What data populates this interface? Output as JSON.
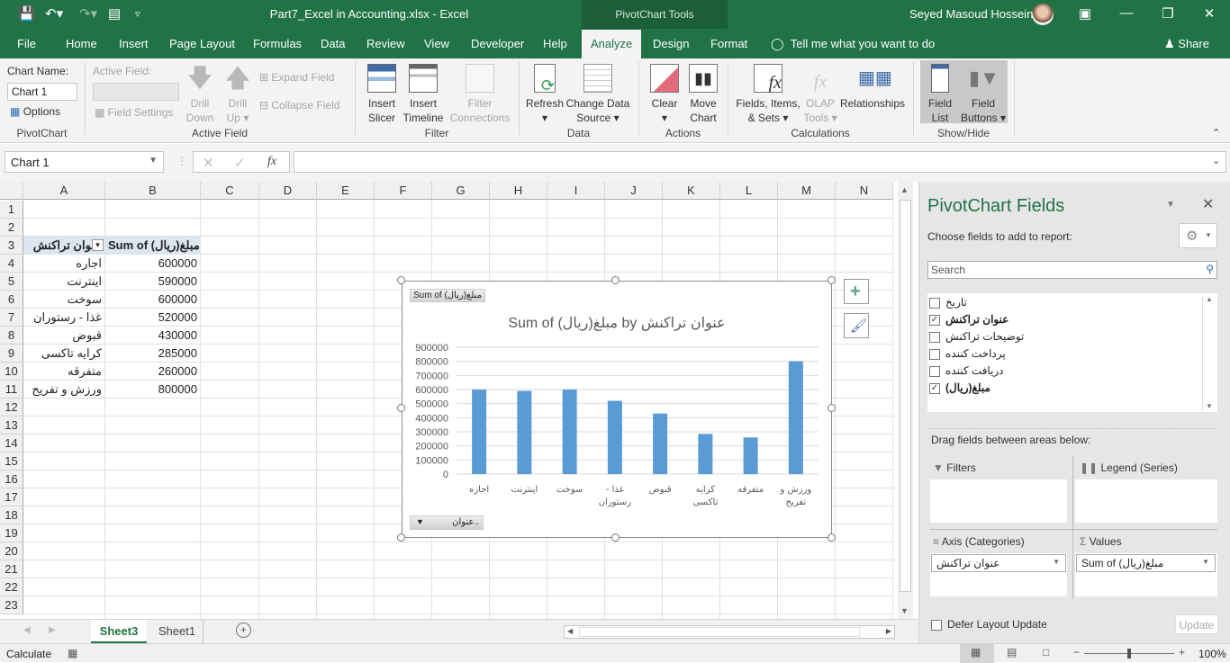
{
  "titlebar": {
    "title": "Part7_Excel in Accounting.xlsx  -  Excel",
    "context_tab_group": "PivotChart Tools",
    "user": "Seyed Masoud Hosseini",
    "icons": [
      "save-icon",
      "undo-icon",
      "redo-icon",
      "form-icon",
      "customize-qat-icon",
      "ribbon-display-icon",
      "minimize-icon",
      "restore-icon",
      "close-icon"
    ]
  },
  "menu": {
    "tabs": [
      "File",
      "Home",
      "Insert",
      "Page Layout",
      "Formulas",
      "Data",
      "Review",
      "View",
      "Developer",
      "Help",
      "Analyze",
      "Design",
      "Format"
    ],
    "active_tab": "Analyze",
    "tell_me": "Tell me what you want to do",
    "share": "Share"
  },
  "ribbon": {
    "pivotchart": {
      "chart_name_label": "Chart Name:",
      "chart_name_value": "Chart 1",
      "options": "Options",
      "group": "PivotChart"
    },
    "active_field": {
      "label": "Active Field:",
      "field_settings": "Field Settings",
      "drill_down": [
        "Drill",
        "Down"
      ],
      "drill_up": [
        "Drill",
        "Up"
      ],
      "expand": "Expand Field",
      "collapse": "Collapse Field",
      "group": "Active Field"
    },
    "filter": {
      "insert_slicer": [
        "Insert",
        "Slicer"
      ],
      "insert_timeline": [
        "Insert",
        "Timeline"
      ],
      "filter_connections": [
        "Filter",
        "Connections"
      ],
      "group": "Filter"
    },
    "data": {
      "refresh": "Refresh",
      "change_source": [
        "Change Data",
        "Source"
      ],
      "group": "Data"
    },
    "actions": {
      "clear": "Clear",
      "move_chart": [
        "Move",
        "Chart"
      ],
      "group": "Actions"
    },
    "calculations": {
      "fields_items": [
        "Fields, Items,",
        "& Sets"
      ],
      "olap": [
        "OLAP",
        "Tools"
      ],
      "relationships": "Relationships",
      "group": "Calculations"
    },
    "showhide": {
      "field_list": [
        "Field",
        "List"
      ],
      "field_buttons": [
        "Field",
        "Buttons"
      ],
      "group": "Show/Hide"
    }
  },
  "formula_bar": {
    "name_box": "Chart 1",
    "formula": ""
  },
  "grid": {
    "columns": [
      "A",
      "B",
      "C",
      "D",
      "E",
      "F",
      "G",
      "H",
      "I",
      "J",
      "K",
      "L",
      "M",
      "N"
    ],
    "rows": [
      "1",
      "2",
      "3",
      "4",
      "5",
      "6",
      "7",
      "8",
      "9",
      "10",
      "11",
      "12",
      "13",
      "14",
      "15",
      "16",
      "17",
      "18",
      "19",
      "20",
      "21",
      "22",
      "23"
    ],
    "pivot_header": [
      "عنوان تراکنش",
      "Sum of مبلغ(ریال)"
    ],
    "pivot_rows": [
      {
        "label": "اجاره",
        "value": "600000"
      },
      {
        "label": "اینترنت",
        "value": "590000"
      },
      {
        "label": "سوخت",
        "value": "600000"
      },
      {
        "label": "غذا - رستوران",
        "value": "520000"
      },
      {
        "label": "قبوض",
        "value": "430000"
      },
      {
        "label": "کرایه تاکسی",
        "value": "285000"
      },
      {
        "label": "متفرقه",
        "value": "260000"
      },
      {
        "label": "ورزش و تفریح",
        "value": "800000"
      }
    ]
  },
  "chart_data": {
    "type": "bar",
    "title": "Sum of مبلغ(ریال) by عنوان تراکنش",
    "value_field_button": "Sum of مبلغ(ریال)",
    "axis_field_button": "عنوان..",
    "categories": [
      "اجاره",
      "اینترنت",
      "سوخت",
      "غذا - رستوران",
      "قبوض",
      "کرایه تاکسی",
      "متفرقه",
      "ورزش و تفریح"
    ],
    "values": [
      600000,
      590000,
      600000,
      520000,
      430000,
      285000,
      260000,
      800000
    ],
    "yticks": [
      "0",
      "100000",
      "200000",
      "300000",
      "400000",
      "500000",
      "600000",
      "700000",
      "800000",
      "900000"
    ],
    "ylim": [
      0,
      900000
    ],
    "xlabel": "",
    "ylabel": "",
    "grid": true,
    "bar_color": "#5b9bd5",
    "legend": "none"
  },
  "sheets": {
    "tabs": [
      "Sheet3",
      "Sheet1"
    ],
    "active": "Sheet3"
  },
  "status": {
    "left": "Calculate",
    "zoom": "100%"
  },
  "pane": {
    "title": "PivotChart Fields",
    "choose": "Choose fields to add to report:",
    "search_placeholder": "Search",
    "fields": [
      {
        "name": "تاریخ",
        "checked": false
      },
      {
        "name": "عنوان تراکنش",
        "checked": true
      },
      {
        "name": "توضیحات تراکنش",
        "checked": false
      },
      {
        "name": "پرداخت کننده",
        "checked": false
      },
      {
        "name": "دریافت کننده",
        "checked": false
      },
      {
        "name": "مبلغ(ریال)",
        "checked": true
      }
    ],
    "drag_label": "Drag fields between areas below:",
    "areas": {
      "filters": "Filters",
      "legend": "Legend (Series)",
      "axis": "Axis (Categories)",
      "values": "Values"
    },
    "axis_field": "عنوان تراکنش",
    "values_field": "Sum of مبلغ(ریال)",
    "defer": "Defer Layout Update",
    "update": "Update"
  },
  "colors": {
    "excel_green": "#217346",
    "accent_bar": "#5b9bd5"
  }
}
